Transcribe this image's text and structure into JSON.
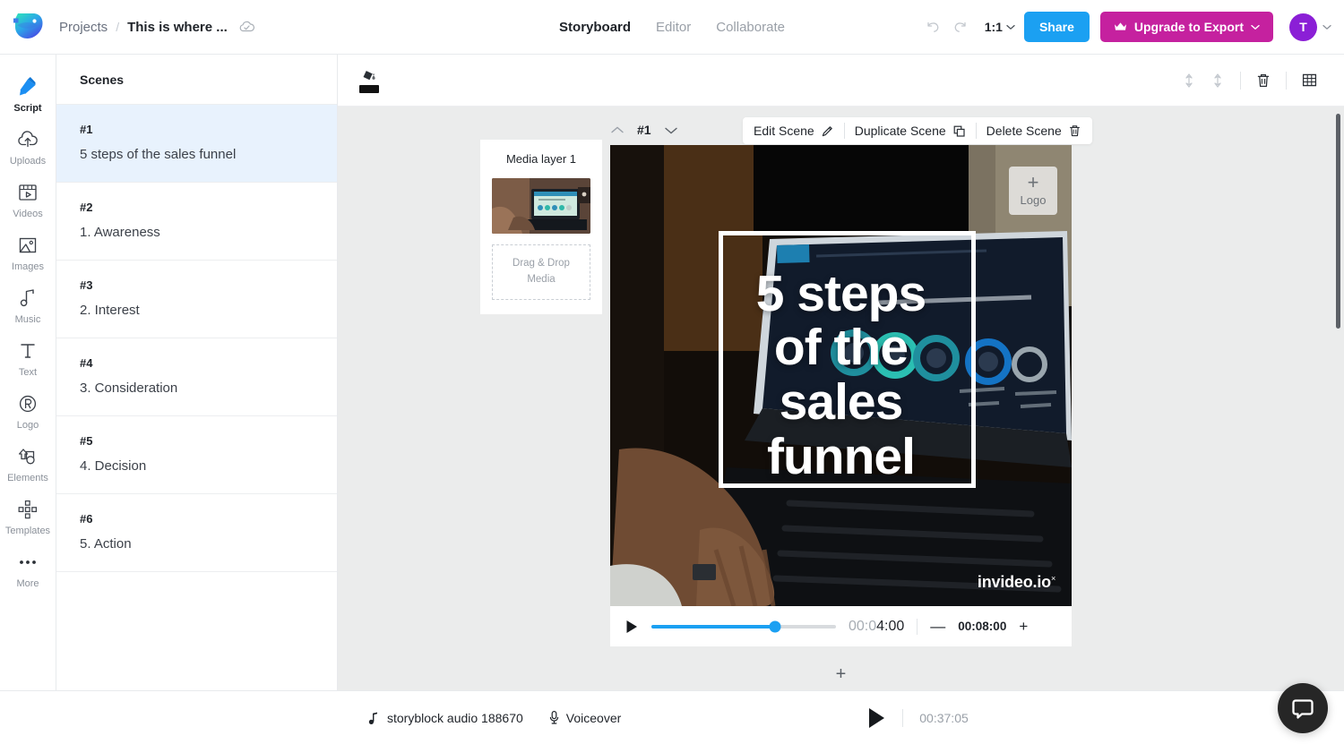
{
  "header": {
    "logo_icon": "invideo-logo-icon",
    "breadcrumb": {
      "projects_label": "Projects",
      "separator": "/",
      "project_title": "This is where ...",
      "cloud_icon": "cloud-saved-icon"
    },
    "tabs": [
      {
        "label": "Storyboard",
        "active": true
      },
      {
        "label": "Editor",
        "active": false
      },
      {
        "label": "Collaborate",
        "active": false
      }
    ],
    "undo_icon": "undo-icon",
    "redo_icon": "redo-icon",
    "aspect_ratio": "1:1",
    "aspect_ratio_chevron": "chevron-down-icon",
    "share_label": "Share",
    "upgrade_label": "Upgrade to Export",
    "upgrade_crown_icon": "crown-icon",
    "upgrade_chevron": "chevron-down-icon",
    "avatar_initial": "T",
    "avatar_chevron": "chevron-down-icon"
  },
  "colors": {
    "share_blue": "#1ba0f2",
    "upgrade_magenta": "#c5219f",
    "avatar_purple": "#8b1fd6",
    "selected_scene_bg": "#e8f2fd",
    "stage_bg": "#ebecec",
    "chat_fab": "#262626"
  },
  "rail": {
    "items": [
      {
        "label": "Script",
        "icon": "script-pen-icon",
        "active": true
      },
      {
        "label": "Uploads",
        "icon": "upload-cloud-icon",
        "active": false
      },
      {
        "label": "Videos",
        "icon": "video-clip-icon",
        "active": false
      },
      {
        "label": "Images",
        "icon": "image-icon",
        "active": false
      },
      {
        "label": "Music",
        "icon": "music-note-icon",
        "active": false
      },
      {
        "label": "Text",
        "icon": "text-t-icon",
        "active": false
      },
      {
        "label": "Logo",
        "icon": "registered-r-icon",
        "active": false
      },
      {
        "label": "Elements",
        "icon": "shapes-icon",
        "active": false
      },
      {
        "label": "Templates",
        "icon": "templates-grid-icon",
        "active": false
      },
      {
        "label": "More",
        "icon": "ellipsis-icon",
        "active": false
      }
    ]
  },
  "scenes_panel": {
    "title": "Scenes",
    "scenes": [
      {
        "num": "#1",
        "text": "5 steps of the sales funnel",
        "selected": true
      },
      {
        "num": "#2",
        "text": "1. Awareness",
        "selected": false
      },
      {
        "num": "#3",
        "text": "2. Interest",
        "selected": false
      },
      {
        "num": "#4",
        "text": "3. Consideration",
        "selected": false
      },
      {
        "num": "#5",
        "text": "4. Decision",
        "selected": false
      },
      {
        "num": "#6",
        "text": "5. Action",
        "selected": false
      }
    ]
  },
  "canvas_toolbar": {
    "fill_tool_icon": "paint-bucket-icon",
    "fill_color": "#121212",
    "move_up_icon": "move-up-icon",
    "move_down_icon": "move-down-icon",
    "delete_icon": "trash-icon",
    "grid_icon": "grid-view-icon"
  },
  "scene_header": {
    "prev_icon": "chevron-up-icon",
    "scene_number": "#1",
    "next_icon": "chevron-down-icon",
    "actions": [
      {
        "label": "Edit Scene",
        "icon": "pencil-icon"
      },
      {
        "label": "Duplicate Scene",
        "icon": "copy-icon"
      },
      {
        "label": "Delete Scene",
        "icon": "trash-icon"
      }
    ]
  },
  "media_layer": {
    "title": "Media layer 1",
    "thumbnail_alt": "person-typing-on-laptop-thumbnail",
    "dropzone_line1": "Drag & Drop",
    "dropzone_line2": "Media"
  },
  "preview": {
    "logo_placeholder": {
      "plus": "+",
      "label": "Logo"
    },
    "title_lines": [
      "5 steps",
      "of the",
      "sales",
      "funnel"
    ],
    "watermark": "invideo.io",
    "watermark_close": "×",
    "background_alt": "hands-typing-laptop-business-stages-diagram"
  },
  "player": {
    "play_icon": "play-icon",
    "progress_percent": 67,
    "current_time_dim": "00:0",
    "current_time_bright": "4:00",
    "minus_label": "—",
    "duration": "00:08:00",
    "plus_label": "+"
  },
  "add_scene_label": "+",
  "bottom_bar": {
    "audio_icon": "music-note-icon",
    "audio_label": "storyblock audio 188670",
    "voiceover_icon": "microphone-icon",
    "voiceover_label": "Voiceover",
    "play_icon": "play-icon",
    "total_time": "00:37:05"
  },
  "chat_widget": {
    "icon": "chat-bubble-icon"
  }
}
